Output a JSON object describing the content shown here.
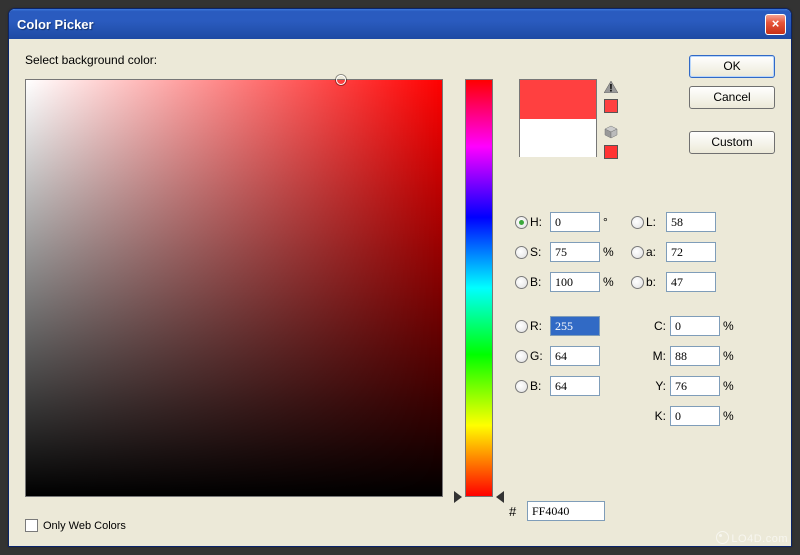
{
  "window": {
    "title": "Color Picker"
  },
  "prompt": "Select background color:",
  "buttons": {
    "ok": "OK",
    "cancel": "Cancel",
    "custom": "Custom"
  },
  "swatch": {
    "new_color": "#FF4040",
    "old_color": "#FFFFFF",
    "mini_new": "#FF4040",
    "mini_websafe": "#FF3333"
  },
  "fields": {
    "h": {
      "label": "H:",
      "value": "0",
      "unit": "°",
      "selected": true
    },
    "s": {
      "label": "S:",
      "value": "75",
      "unit": "%",
      "selected": false
    },
    "bhsb": {
      "label": "B:",
      "value": "100",
      "unit": "%",
      "selected": false
    },
    "l": {
      "label": "L:",
      "value": "58",
      "unit": "",
      "selected": false
    },
    "a": {
      "label": "a:",
      "value": "72",
      "unit": "",
      "selected": false
    },
    "blab": {
      "label": "b:",
      "value": "47",
      "unit": "",
      "selected": false
    },
    "r": {
      "label": "R:",
      "value": "255",
      "unit": "",
      "selected": false,
      "highlighted": true
    },
    "g": {
      "label": "G:",
      "value": "64",
      "unit": "",
      "selected": false
    },
    "brgb": {
      "label": "B:",
      "value": "64",
      "unit": "",
      "selected": false
    },
    "c": {
      "label": "C:",
      "value": "0",
      "unit": "%"
    },
    "m": {
      "label": "M:",
      "value": "88",
      "unit": "%"
    },
    "y": {
      "label": "Y:",
      "value": "76",
      "unit": "%"
    },
    "k": {
      "label": "K:",
      "value": "0",
      "unit": "%"
    }
  },
  "hex": {
    "label": "#",
    "value": "FF4040"
  },
  "webcolors": {
    "label": "Only Web Colors",
    "checked": false
  },
  "watermark": "LO4D.com"
}
